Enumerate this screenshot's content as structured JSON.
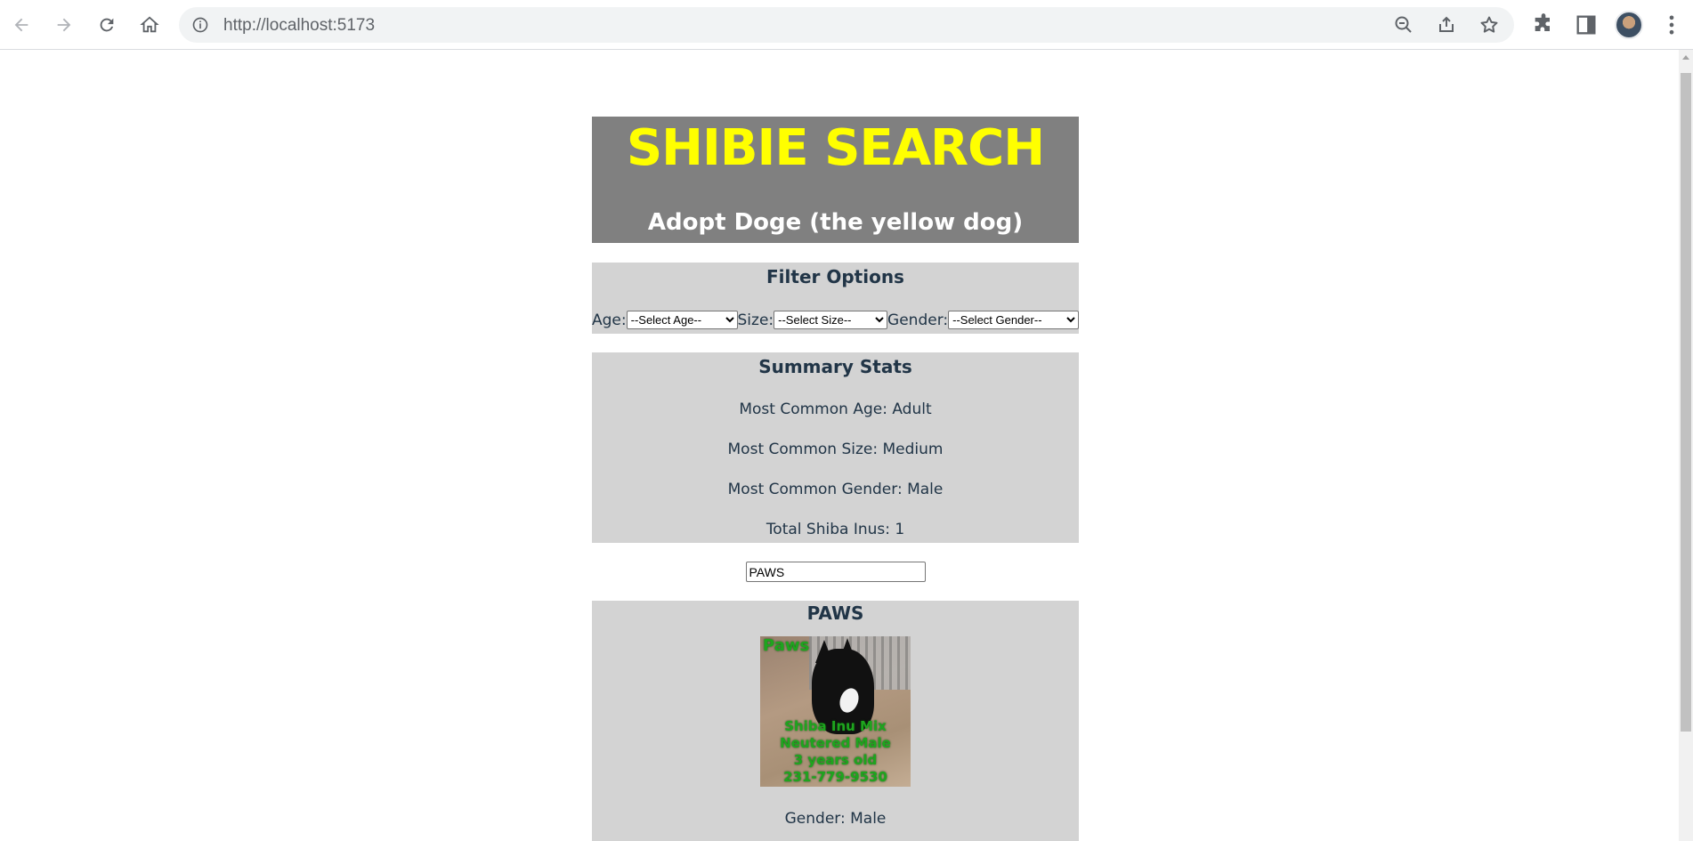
{
  "browser": {
    "url": "http://localhost:5173"
  },
  "header": {
    "title": "SHIBIE SEARCH",
    "subtitle": "Adopt Doge (the yellow dog)"
  },
  "filters": {
    "heading": "Filter Options",
    "age_label": "Age:",
    "age_selected": "--Select Age--",
    "size_label": "Size:",
    "size_selected": "--Select Size--",
    "gender_label": "Gender:",
    "gender_selected": "--Select Gender--"
  },
  "stats": {
    "heading": "Summary Stats",
    "common_age": "Most Common Age: Adult",
    "common_size": "Most Common Size: Medium",
    "common_gender": "Most Common Gender: Male",
    "total": "Total Shiba Inus: 1"
  },
  "search": {
    "value": "PAWS"
  },
  "dog": {
    "name": "PAWS",
    "photo_text": {
      "top": "Paws",
      "line1": "Shiba Inu Mix",
      "line2": "Neutered Male",
      "line3": "3 years old",
      "line4": "231-779-9530"
    },
    "gender": "Gender: Male"
  }
}
